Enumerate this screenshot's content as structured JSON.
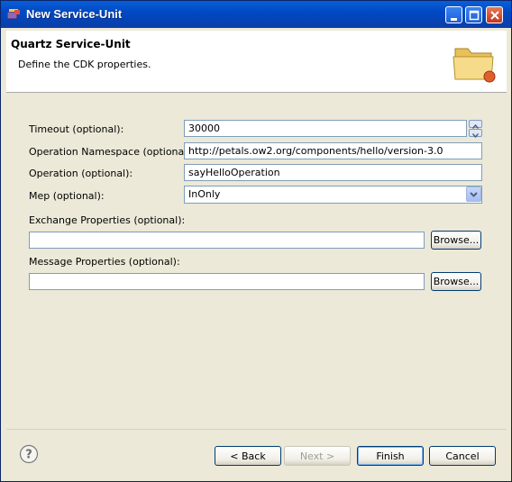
{
  "window": {
    "title": "New Service-Unit",
    "icons": {
      "app": "eclipse-wizard-icon",
      "minimize": "minimize-icon",
      "maximize": "maximize-icon",
      "close": "close-icon"
    },
    "colors": {
      "titlebar": "#0a4fc7",
      "close": "#d9542f",
      "dialog_bg": "#ece9d8"
    }
  },
  "header": {
    "title": "Quartz Service-Unit",
    "description": "Define the CDK properties.",
    "image": "folder-icon"
  },
  "form": {
    "timeout": {
      "label": "Timeout (optional):",
      "value": "30000"
    },
    "namespace": {
      "label": "Operation Namespace (optional):",
      "value": "http://petals.ow2.org/components/hello/version-3.0"
    },
    "operation": {
      "label": "Operation (optional):",
      "value": "sayHelloOperation"
    },
    "mep": {
      "label": "Mep (optional):",
      "value": "InOnly"
    },
    "exchange_properties": {
      "label": "Exchange Properties (optional):",
      "value": "",
      "browse_label": "Browse..."
    },
    "message_properties": {
      "label": "Message Properties (optional):",
      "value": "",
      "browse_label": "Browse..."
    }
  },
  "footer": {
    "help_icon": "help-icon",
    "back_label": "< Back",
    "next_label": "Next >",
    "finish_label": "Finish",
    "cancel_label": "Cancel"
  }
}
